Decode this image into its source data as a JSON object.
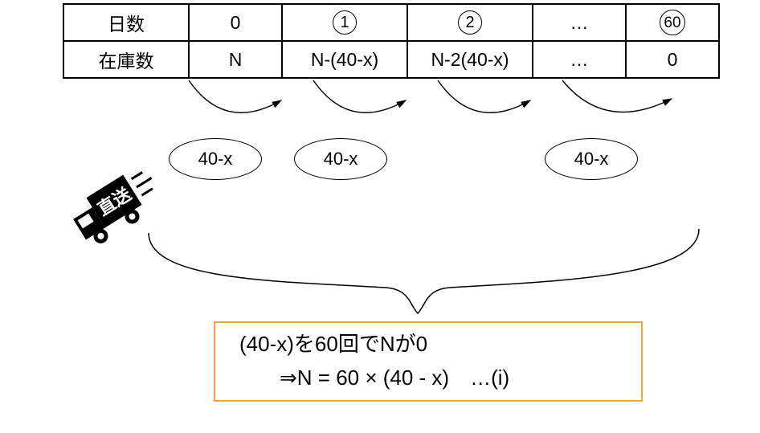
{
  "table": {
    "row1_label": "日数",
    "row2_label": "在庫数",
    "d0": "0",
    "d1": "1",
    "d2": "2",
    "d_dots": "…",
    "d_last": "60",
    "s0": "N",
    "s1": "N-(40-x)",
    "s2": "N-2(40-x)",
    "s_dots": "…",
    "s_last": "0"
  },
  "ovals": {
    "o1": "40-x",
    "o2": "40-x",
    "o3": "40-x"
  },
  "truck": {
    "label": "直送"
  },
  "conclusion": {
    "line1": "(40-x)を60回でNが0",
    "line2": "⇒N = 60 × (40 - x)　…(i)"
  },
  "chart_data": {
    "type": "table",
    "description": "Arithmetic depletion sequence: stock N decreases by (40-x) each day, reaching 0 on day 60.",
    "columns": [
      "日数",
      "在庫数"
    ],
    "rows": [
      {
        "day": "0",
        "stock": "N"
      },
      {
        "day": "1",
        "stock": "N-(40-x)"
      },
      {
        "day": "2",
        "stock": "N-2(40-x)"
      },
      {
        "day": "…",
        "stock": "…"
      },
      {
        "day": "60",
        "stock": "0"
      }
    ],
    "daily_decrement": "40-x",
    "iterations": 60,
    "equation": "N = 60 × (40 - x)"
  }
}
